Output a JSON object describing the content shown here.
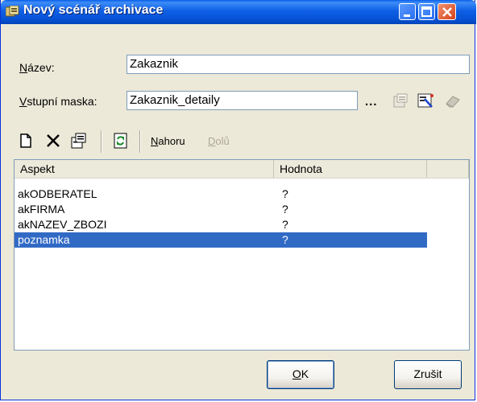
{
  "window": {
    "title": "Nový scénář archivace",
    "title_icon": "archive-scenario-icon",
    "controls": [
      "minimize-icon",
      "maximize-icon",
      "close-icon"
    ]
  },
  "form": {
    "name_label_mnemonic": "N",
    "name_label_rest": "ázev:",
    "name_value": "Zakaznik",
    "mask_label_mnemonic": "V",
    "mask_label_rest": "stupní maska:",
    "mask_value": "Zakaznik_detaily",
    "browse_label": "...",
    "mask_icons": [
      "properties-icon",
      "wizard-icon",
      "eraser-icon"
    ]
  },
  "toolbar": {
    "icons": [
      "new-icon",
      "delete-icon",
      "properties-icon",
      "refresh-icon"
    ],
    "up_mnemonic": "N",
    "up_rest": "ahoru",
    "down_mnemonic": "D",
    "down_rest": "olů"
  },
  "list": {
    "columns": [
      "Aspekt",
      "Hodnota"
    ],
    "rows": [
      {
        "aspect": "akODBERATEL",
        "value": "?"
      },
      {
        "aspect": "akFIRMA",
        "value": "?"
      },
      {
        "aspect": "akNAZEV_ZBOZI",
        "value": "?"
      },
      {
        "aspect": "poznamka",
        "value": "?"
      }
    ],
    "selected_row": "poznamka"
  },
  "buttons": {
    "ok_mnemonic": "O",
    "ok_rest": "K",
    "cancel_label": "Zrušit"
  },
  "colors": {
    "titlebar": "#0a5ee8",
    "selection": "#316ac5",
    "dialog_bg": "#ece9d8"
  }
}
